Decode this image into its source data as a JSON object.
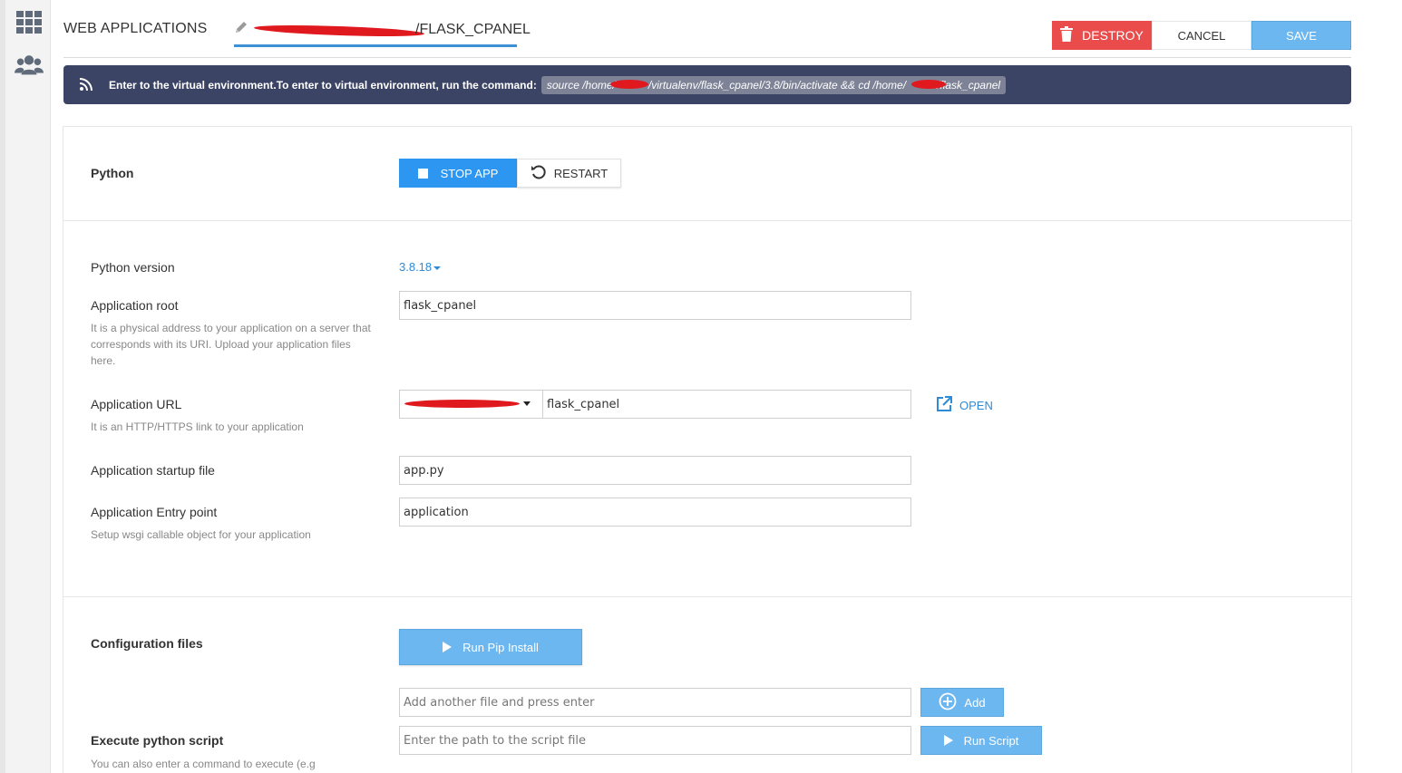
{
  "rail": {
    "icons": [
      "apps-grid-icon",
      "users-icon"
    ]
  },
  "header": {
    "title": "WEB APPLICATIONS",
    "app_name": "/FLASK_CPANEL",
    "destroy_label": "DESTROY",
    "cancel_label": "CANCEL",
    "save_label": "SAVE"
  },
  "banner": {
    "message": "Enter to the virtual environment.To enter to virtual environment, run the command:",
    "command_part1": "source /home/",
    "command_part2": "/virtualenv/flask_cpanel/3.8/bin/activate && cd /home/",
    "command_part3": "/flask_cpanel"
  },
  "python_section": {
    "title": "Python",
    "stop_label": "STOP APP",
    "restart_label": "RESTART"
  },
  "settings": {
    "python_version_label": "Python version",
    "python_version_value": "3.8.18",
    "app_root_label": "Application root",
    "app_root_hint": "It is a physical address to your application on a server that corresponds with its URI. Upload your application files here.",
    "app_root_value": "flask_cpanel",
    "app_url_label": "Application URL",
    "app_url_hint": "It is an HTTP/HTTPS link to your application",
    "app_url_value": "flask_cpanel",
    "open_label": "OPEN",
    "startup_label": "Application startup file",
    "startup_value": "app.py",
    "entry_label": "Application Entry point",
    "entry_hint": "Setup wsgi callable object for your application",
    "entry_value": "application"
  },
  "config_section": {
    "title": "Configuration files",
    "pip_label": "Run Pip Install",
    "add_file_placeholder": "Add another file and press enter",
    "add_label": "Add",
    "script_title": "Execute python script",
    "script_hint": "You can also enter a command to execute (e.g",
    "script_placeholder": "Enter the path to the script file",
    "run_script_label": "Run Script"
  },
  "colors": {
    "accent": "#2d96f0",
    "accent_light": "#6cb7f0",
    "danger": "#ea4b4b",
    "banner_bg": "#3c4466",
    "link": "#2d8bd8"
  }
}
